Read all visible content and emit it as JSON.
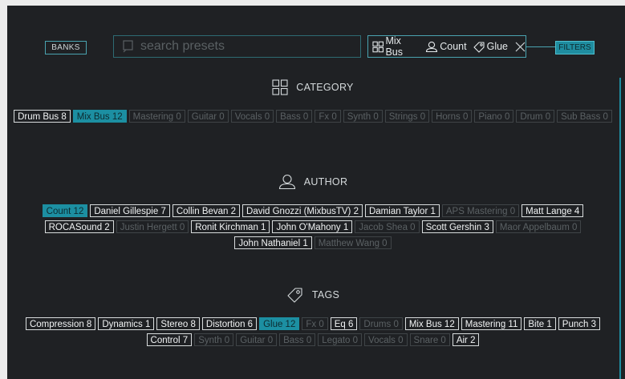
{
  "toolbar": {
    "banks_label": "BANKS",
    "search_placeholder": "search presets",
    "search_value": "",
    "active_filters": [
      {
        "icon": "grid-icon",
        "label": "Mix Bus"
      },
      {
        "icon": "user-icon",
        "label": "Count"
      },
      {
        "icon": "tag-icon",
        "label": "Glue"
      }
    ],
    "filters_label": "FILTERS"
  },
  "sections": {
    "category": {
      "title": "CATEGORY",
      "icon": "grid-icon",
      "items": [
        {
          "label": "Drum Bus 8",
          "state": "active"
        },
        {
          "label": "Mix Bus 12",
          "state": "selected"
        },
        {
          "label": "Mastering 0",
          "state": "dim"
        },
        {
          "label": "Guitar 0",
          "state": "dim"
        },
        {
          "label": "Vocals 0",
          "state": "dim"
        },
        {
          "label": "Bass 0",
          "state": "dim"
        },
        {
          "label": "Fx 0",
          "state": "dim"
        },
        {
          "label": "Synth 0",
          "state": "dim"
        },
        {
          "label": "Strings 0",
          "state": "dim"
        },
        {
          "label": "Horns 0",
          "state": "dim"
        },
        {
          "label": "Piano 0",
          "state": "dim"
        },
        {
          "label": "Drum 0",
          "state": "dim"
        },
        {
          "label": "Sub Bass 0",
          "state": "dim"
        }
      ]
    },
    "author": {
      "title": "AUTHOR",
      "icon": "user-icon",
      "items": [
        {
          "label": "Count 12",
          "state": "selected"
        },
        {
          "label": "Daniel Gillespie 7",
          "state": "active"
        },
        {
          "label": "Collin Bevan 2",
          "state": "active"
        },
        {
          "label": "David Gnozzi (MixbusTV) 2",
          "state": "active"
        },
        {
          "label": "Damian Taylor 1",
          "state": "active"
        },
        {
          "label": "APS Mastering 0",
          "state": "dim"
        },
        {
          "label": "Matt Lange 4",
          "state": "active"
        },
        {
          "label": "ROCASound 2",
          "state": "active"
        },
        {
          "label": "Justin Hergett 0",
          "state": "dim"
        },
        {
          "label": "Ronit Kirchman 1",
          "state": "active"
        },
        {
          "label": "John O'Mahony 1",
          "state": "active"
        },
        {
          "label": "Jacob Shea 0",
          "state": "dim"
        },
        {
          "label": "Scott Gershin 3",
          "state": "active"
        },
        {
          "label": "Maor Appelbaum 0",
          "state": "dim"
        },
        {
          "label": "John Nathaniel 1",
          "state": "active"
        },
        {
          "label": "Matthew Wang 0",
          "state": "dim"
        }
      ]
    },
    "tags": {
      "title": "TAGS",
      "icon": "tag-icon",
      "items": [
        {
          "label": "Compression 8",
          "state": "active"
        },
        {
          "label": "Dynamics 1",
          "state": "active"
        },
        {
          "label": "Stereo 8",
          "state": "active"
        },
        {
          "label": "Distortion 6",
          "state": "active"
        },
        {
          "label": "Glue 12",
          "state": "selected"
        },
        {
          "label": "Fx 0",
          "state": "dim"
        },
        {
          "label": "Eq 6",
          "state": "active"
        },
        {
          "label": "Drums 0",
          "state": "dim"
        },
        {
          "label": "Mix Bus 12",
          "state": "active"
        },
        {
          "label": "Mastering 11",
          "state": "active"
        },
        {
          "label": "Bite 1",
          "state": "active"
        },
        {
          "label": "Punch 3",
          "state": "active"
        },
        {
          "label": "Control 7",
          "state": "active"
        },
        {
          "label": "Synth 0",
          "state": "dim"
        },
        {
          "label": "Guitar 0",
          "state": "dim"
        },
        {
          "label": "Bass 0",
          "state": "dim"
        },
        {
          "label": "Legato 0",
          "state": "dim"
        },
        {
          "label": "Vocals 0",
          "state": "dim"
        },
        {
          "label": "Snare 0",
          "state": "dim"
        },
        {
          "label": "Air 2",
          "state": "active"
        }
      ]
    }
  },
  "colors": {
    "background": "#1f2124",
    "accent": "#1c8fa2",
    "active_border": "#d8dcdd",
    "dim_text": "#5b6164"
  }
}
